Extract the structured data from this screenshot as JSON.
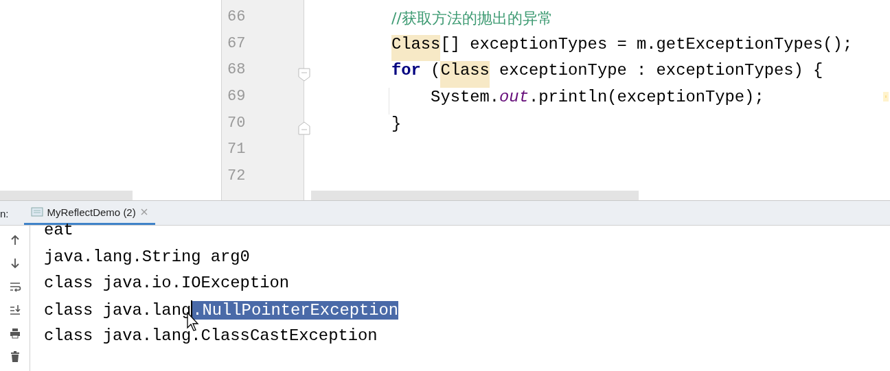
{
  "editor": {
    "lines": [
      {
        "number": "66",
        "fold_start": false,
        "fold_end": false,
        "segments": [
          {
            "kind": "comment",
            "text": "//获取方法的抛出的异常"
          }
        ]
      },
      {
        "number": "67",
        "fold_start": false,
        "fold_end": false,
        "segments": [
          {
            "kind": "usage",
            "text": "Class"
          },
          {
            "kind": "plain",
            "text": "[] exceptionTypes = m.getExceptionTypes();"
          }
        ]
      },
      {
        "number": "68",
        "fold_start": true,
        "fold_end": false,
        "segments": [
          {
            "kind": "keyword",
            "text": "for"
          },
          {
            "kind": "plain",
            "text": " ("
          },
          {
            "kind": "usage",
            "text": "Class"
          },
          {
            "kind": "plain",
            "text": " exceptionType : exceptionTypes) {"
          }
        ]
      },
      {
        "number": "69",
        "fold_start": false,
        "fold_end": false,
        "guide": true,
        "segments": [
          {
            "kind": "plain",
            "text": "    System."
          },
          {
            "kind": "field",
            "text": "out"
          },
          {
            "kind": "plain",
            "text": ".println(exceptionType);"
          }
        ]
      },
      {
        "number": "70",
        "fold_start": false,
        "fold_end": true,
        "segments": [
          {
            "kind": "plain",
            "text": "}"
          }
        ]
      },
      {
        "number": "71",
        "fold_start": false,
        "fold_end": false
      },
      {
        "number": "72",
        "fold_start": false,
        "fold_end": false
      }
    ]
  },
  "run_panel": {
    "label": "n:",
    "tabs": [
      {
        "label": "MyReflectDemo (2)",
        "selected": true
      }
    ],
    "output": [
      {
        "segments": [
          {
            "text": "eat",
            "selected": false
          }
        ]
      },
      {
        "segments": [
          {
            "text": "java.lang.String arg0",
            "selected": false
          }
        ]
      },
      {
        "segments": [
          {
            "text": "class java.io.IOException",
            "selected": false
          }
        ]
      },
      {
        "segments": [
          {
            "text": "class java.lang",
            "selected": false
          },
          {
            "text": ".NullPointerException",
            "selected": true
          }
        ]
      },
      {
        "segments": [
          {
            "text": "class java.lang.ClassCastException",
            "selected": false
          }
        ]
      }
    ]
  }
}
